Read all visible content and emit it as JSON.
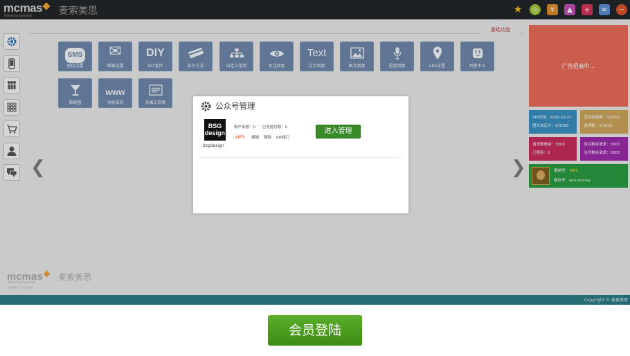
{
  "header": {
    "logo_word": "mcmas",
    "logo_cn": "麦索美思",
    "logo_sub": "Marketing Specialist",
    "icons": [
      "star-icon",
      "coin-icon",
      "yuan-icon",
      "image-icon",
      "plus-icon",
      "list-icon",
      "minus-icon"
    ],
    "icon_colors": [
      "#f2b824",
      "#9ac234",
      "#d98a2c",
      "#c04fb2",
      "#d1365a",
      "#5b8ccf",
      "#d9532c"
    ]
  },
  "sidebar": {
    "items": [
      "gear-icon",
      "phone-icon",
      "people-icon",
      "grid-icon",
      "cart-icon",
      "user-icon",
      "chat-icon"
    ]
  },
  "section_tab": "基础功能",
  "tiles": [
    {
      "glyph": "SMS",
      "label": "短信设置"
    },
    {
      "glyph": "✉",
      "label": "邮箱设置"
    },
    {
      "glyph": "DIY",
      "label": "DIY宣传"
    },
    {
      "glyph": "▭",
      "label": "支付方式"
    },
    {
      "glyph": "品",
      "label": "自定义菜单"
    },
    {
      "glyph": "◉",
      "label": "关注回复"
    },
    {
      "glyph": "Text",
      "label": "文字回复"
    },
    {
      "glyph": "▣",
      "label": "图文回复"
    },
    {
      "glyph": "♪",
      "label": "语音回复"
    },
    {
      "glyph": "⚲",
      "label": "LBS设置"
    },
    {
      "glyph": "▢",
      "label": "回答不上"
    },
    {
      "glyph": "Y",
      "label": "微商圈"
    },
    {
      "glyph": "www",
      "label": "功能域名"
    },
    {
      "glyph": "☰",
      "label": "多图文回复"
    }
  ],
  "nav": {
    "prev": "❮",
    "next": "❯"
  },
  "right_panel": {
    "ad_text": "广告招商中...",
    "cards": [
      {
        "line1": "VIP时间：2020-01-01",
        "line2": "图文自定义：0/3000",
        "color": "#3a8fc0"
      },
      {
        "line1": "活动创建数：0/3000",
        "line2": "请求数：0/3000",
        "color": "#c9a35a"
      },
      {
        "line1": "请求数剩余：3000",
        "line2": "已使用：0",
        "color": "#c42c5a"
      },
      {
        "line1": "当月剩余请求：3000",
        "line2": "当月剩余请求：3000",
        "color": "#9a2aa8"
      }
    ],
    "user": {
      "name": "蕾蛇吧",
      "vip": "VIP3",
      "wechat": "微信号：iam-money"
    }
  },
  "bottom_logo": {
    "word": "mcmas",
    "cn": "麦索美思",
    "sub": "Marketing Specialist",
    "small": "品牌营销专家 专注微信营销"
  },
  "footer": {
    "text": "Copyright © 麦索美思"
  },
  "dialog": {
    "title": "公众号管理",
    "account": {
      "logo_line1": "BSG",
      "logo_line2": "design",
      "name": "bsgdesign",
      "balance": "账户余额：0",
      "recharge": "已充值总数：0",
      "vip": "VIP3",
      "edit": "编辑",
      "delete": "删除",
      "api": "AIP接口"
    },
    "enter_button": "进入管理"
  },
  "login_button": "会员登陆"
}
